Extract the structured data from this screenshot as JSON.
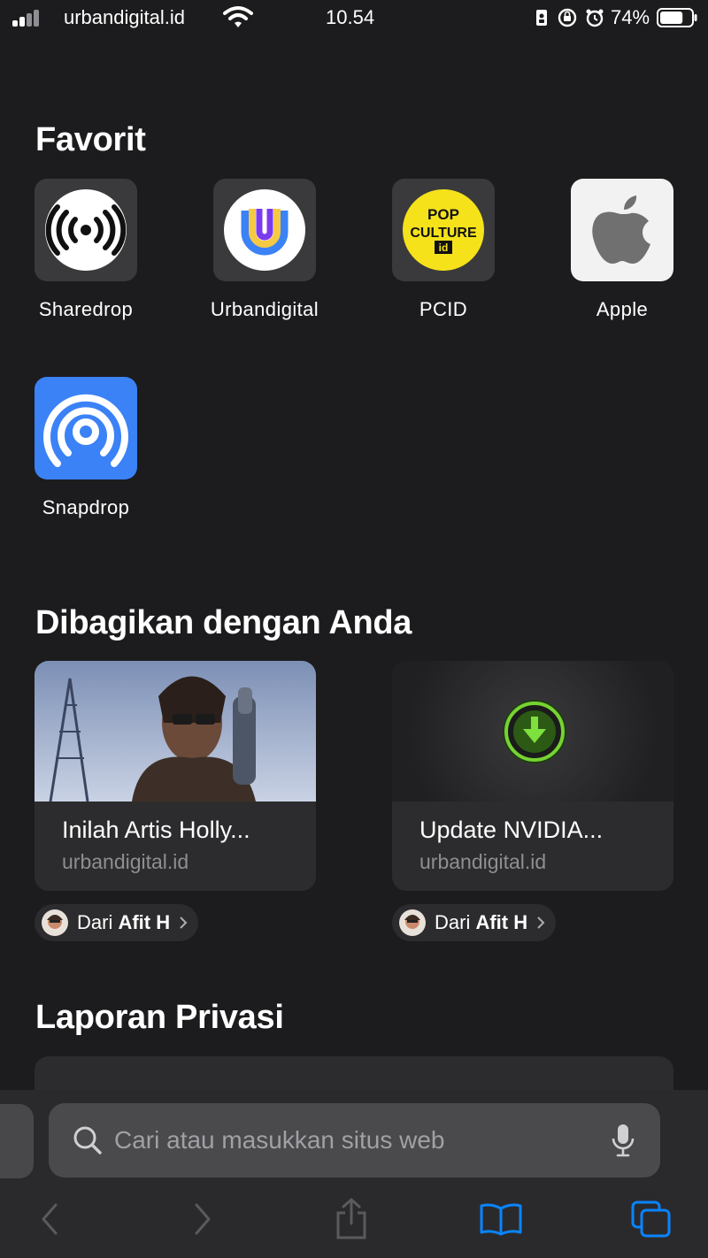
{
  "status_bar": {
    "carrier": "urbandigital.id",
    "time": "10.54",
    "battery_percent": "74%",
    "battery_level": 0.74,
    "icons": [
      "signal-icon",
      "wifi-icon",
      "sim-icon",
      "orientation-lock-icon",
      "alarm-icon",
      "battery-icon"
    ]
  },
  "favorites": {
    "title": "Favorit",
    "items": [
      {
        "label": "Sharedrop",
        "icon": "sharedrop-icon"
      },
      {
        "label": "Urbandigital",
        "icon": "urbandigital-icon"
      },
      {
        "label": "PCID",
        "icon": "popculture-icon",
        "logo_text": "POP CULTURE id"
      },
      {
        "label": "Apple",
        "icon": "apple-icon"
      },
      {
        "label": "Snapdrop",
        "icon": "snapdrop-icon"
      }
    ]
  },
  "shared": {
    "title": "Dibagikan dengan Anda",
    "cards": [
      {
        "title": "Inilah Artis Holly...",
        "site": "urbandigital.id",
        "from_prefix": "Dari",
        "from_name": "Afit H"
      },
      {
        "title": "Update NVIDIA...",
        "site": "urbandigital.id",
        "from_prefix": "Dari",
        "from_name": "Afit H"
      }
    ]
  },
  "privacy": {
    "title": "Laporan Privasi"
  },
  "search": {
    "placeholder": "Cari atau masukkan situs web"
  },
  "toolbar": {
    "buttons": [
      "back-icon",
      "forward-icon",
      "share-icon",
      "bookmarks-icon",
      "tabs-icon"
    ],
    "accent_color": "#0a84ff",
    "disabled_color": "#5a5a5e"
  }
}
